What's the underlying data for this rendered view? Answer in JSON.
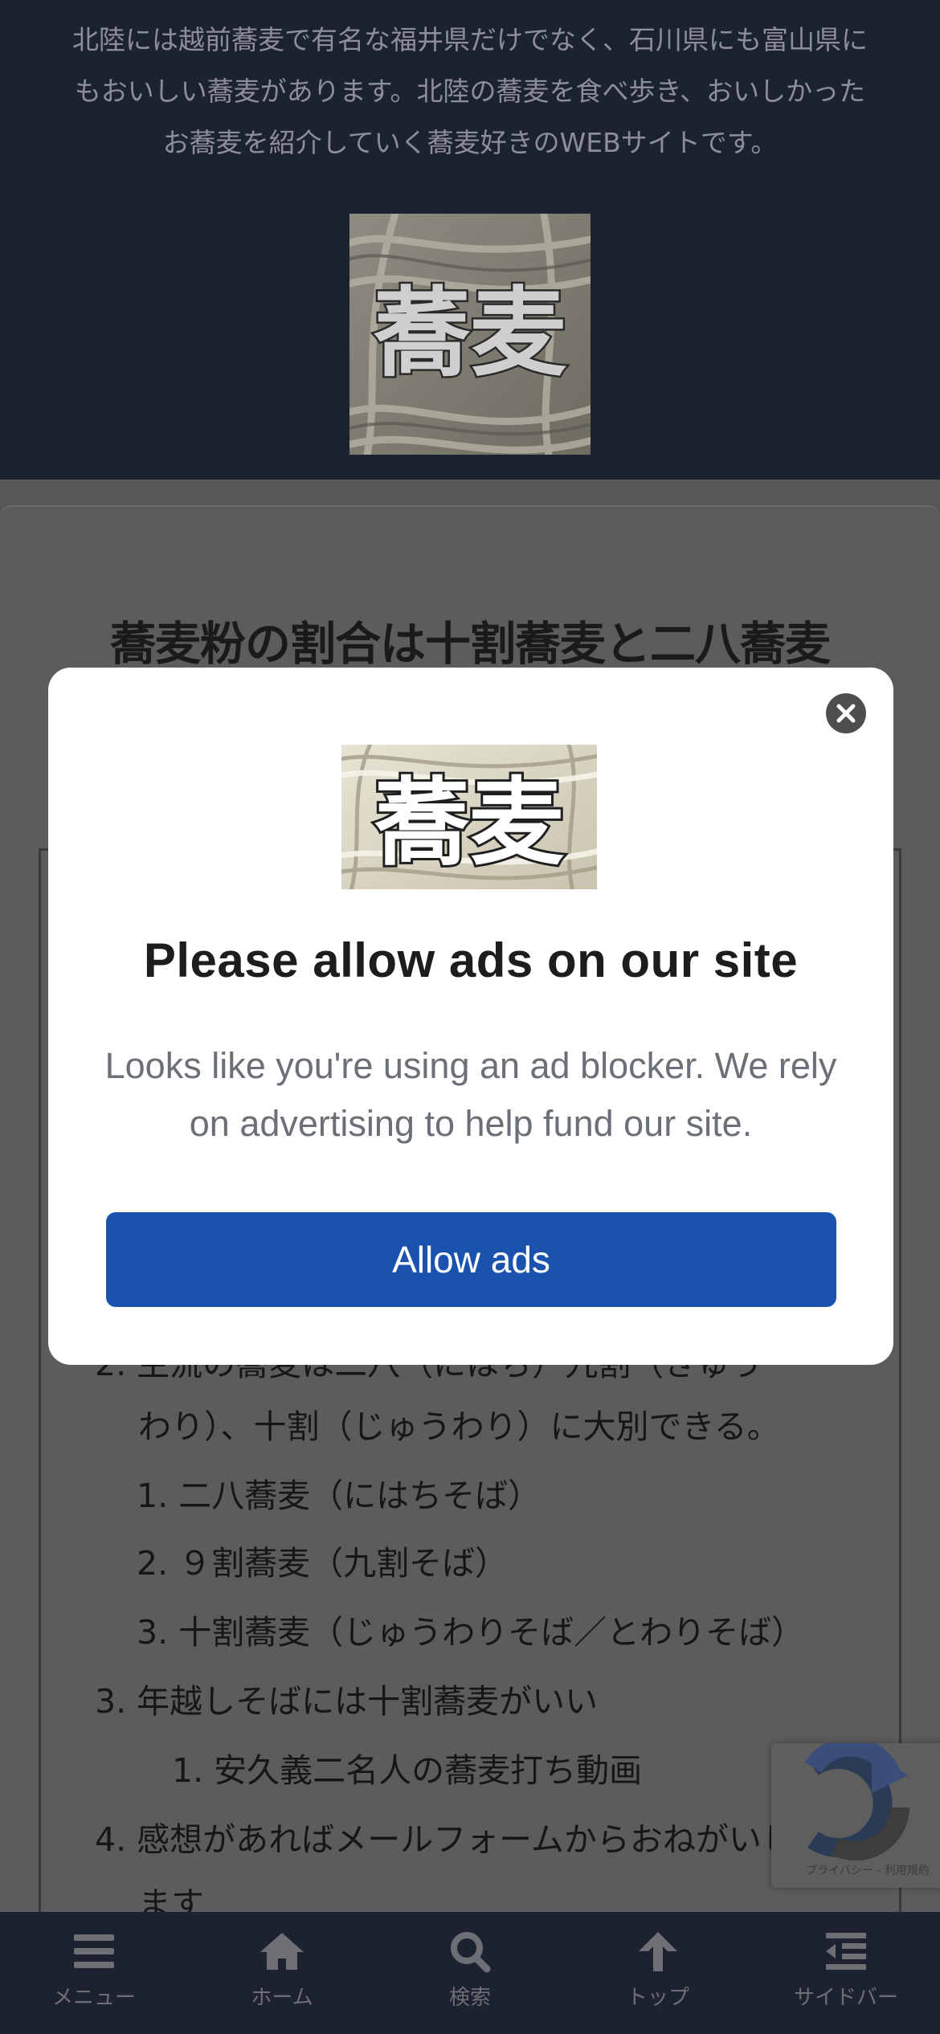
{
  "header": {
    "description_lines": [
      "北陸には越前蕎麦で有名な福井県だけでなく、石川県にも富山県に",
      "もおいしい蕎麦があります。北陸の蕎麦を食べ歩き、おいしかった",
      "お蕎麦を紹介していく蕎麦好きのWEBサイトです。"
    ],
    "logo_text": "蕎麦"
  },
  "article": {
    "title": "蕎麦粉の割合は十割蕎麦と二八蕎麦",
    "toc": [
      "2. 主流の蕎麦は二八（にはち）九割（きゅう",
      "わり）、十割（じゅうわり）に大別できる。",
      "1. 二八蕎麦（にはちそば）",
      "2. ９割蕎麦（九割そば）",
      "3. 十割蕎麦（じゅうわりそば／とわりそば）",
      "3. 年越しそばには十割蕎麦がいい",
      "1. 安久義二名人の蕎麦打ち動画",
      "4. 感想があればメールフォームからおねがいし",
      "ます"
    ]
  },
  "recaptcha": {
    "text": "プライバシー - 利用規約"
  },
  "modal": {
    "logo_text": "蕎麦",
    "title": "Please allow ads on our site",
    "body": "Looks like you're using an ad blocker. We rely on advertising to help fund our site.",
    "button_label": "Allow ads"
  },
  "bottom_nav": {
    "items": [
      {
        "label": "メニュー",
        "icon": "menu-icon"
      },
      {
        "label": "ホーム",
        "icon": "home-icon"
      },
      {
        "label": "検索",
        "icon": "search-icon"
      },
      {
        "label": "トップ",
        "icon": "arrow-up-icon"
      },
      {
        "label": "サイドバー",
        "icon": "sidebar-icon"
      }
    ]
  },
  "colors": {
    "header_bg": "#1c2230",
    "overlay_content": "#575757",
    "button_blue": "#1a52ad",
    "modal_bg": "#ffffff"
  }
}
